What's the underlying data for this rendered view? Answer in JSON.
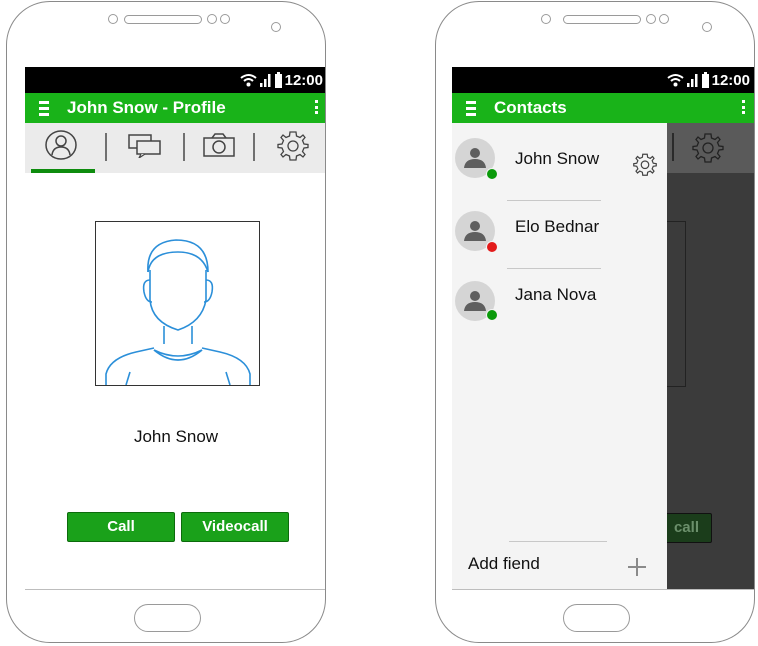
{
  "status_bar": {
    "time": "12:00"
  },
  "profile_screen": {
    "app_title": "John Snow - Profile",
    "tabs": [
      {
        "icon": "profile-icon",
        "selected": true
      },
      {
        "icon": "chat-icon",
        "selected": false
      },
      {
        "icon": "camera-icon",
        "selected": false
      },
      {
        "icon": "gear-icon",
        "selected": false
      }
    ],
    "profile_name": "John Snow",
    "call_label": "Call",
    "videocall_label": "Videocall"
  },
  "contacts_screen": {
    "app_title": "Contacts",
    "contacts": [
      {
        "name": "John Snow",
        "status_color": "#0a9a0a"
      },
      {
        "name": "Elo Bednar",
        "status_color": "#e31b1b"
      },
      {
        "name": "Jana Nova",
        "status_color": "#0a9a0a"
      }
    ],
    "background_button_fragment": "call",
    "add_friend_label": "Add fiend"
  },
  "colors": {
    "accent_green": "#19b319",
    "button_green": "#1aa11a",
    "status_bar": "#000000",
    "outline_blue": "#2b8fd9"
  }
}
